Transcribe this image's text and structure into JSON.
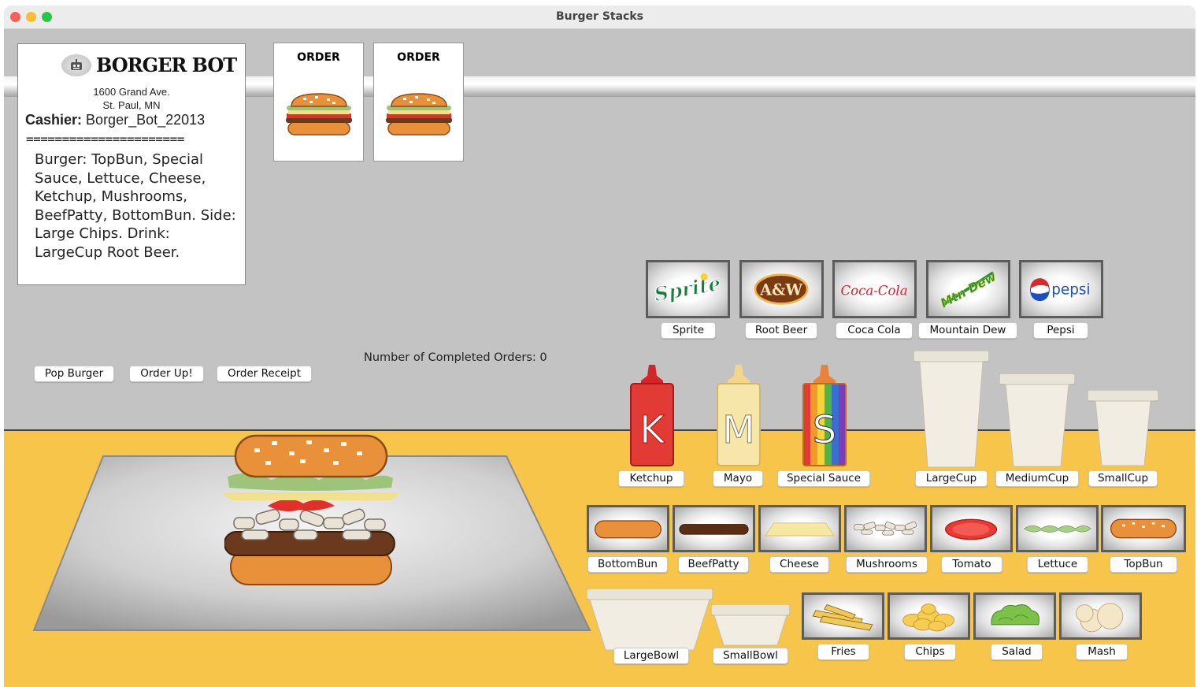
{
  "window": {
    "title": "Burger Stacks"
  },
  "receipt": {
    "brand": "BORGER BOT",
    "address_line1": "1600 Grand Ave.",
    "address_line2": "St. Paul, MN",
    "cashier_label": "Cashier:",
    "cashier_name": "Borger_Bot_22013",
    "divider": "======================",
    "order_text": "Burger: TopBun, Special Sauce, Lettuce, Cheese, Ketchup, Mushrooms, BeefPatty, BottomBun. Side: Large Chips. Drink: LargeCup Root Beer."
  },
  "tickets": [
    {
      "label": "ORDER"
    },
    {
      "label": "ORDER"
    }
  ],
  "actions": {
    "pop_burger": "Pop Burger",
    "order_up": "Order Up!",
    "order_receipt": "Order Receipt"
  },
  "status": {
    "completed_orders": "Number of Completed Orders: 0"
  },
  "drinks": {
    "sprite": {
      "label": "Sprite",
      "logo": "Sprite"
    },
    "root_beer": {
      "label": "Root Beer",
      "logo": "A&W"
    },
    "coca_cola": {
      "label": "Coca Cola",
      "logo": "Coca-Cola"
    },
    "mountain_dew": {
      "label": "Mountain Dew",
      "logo": "Mtn Dew"
    },
    "pepsi": {
      "label": "Pepsi",
      "logo": "pepsi"
    }
  },
  "sauces": {
    "ketchup": {
      "label": "Ketchup",
      "letter": "K"
    },
    "mayo": {
      "label": "Mayo",
      "letter": "M"
    },
    "special_sauce": {
      "label": "Special Sauce",
      "letter": "S"
    }
  },
  "cups": {
    "large": "LargeCup",
    "medium": "MediumCup",
    "small": "SmallCup"
  },
  "ingredients": {
    "bottom_bun": "BottomBun",
    "beef_patty": "BeefPatty",
    "cheese": "Cheese",
    "mushrooms": "Mushrooms",
    "tomato": "Tomato",
    "lettuce": "Lettuce",
    "top_bun": "TopBun"
  },
  "bowls": {
    "large": "LargeBowl",
    "small": "SmallBowl"
  },
  "sides": {
    "fries": "Fries",
    "chips": "Chips",
    "salad": "Salad",
    "mash": "Mash"
  },
  "colors": {
    "floor": "#f6c54a",
    "backdrop": "#c3c3c3",
    "tile_border": "#5c5c5c"
  }
}
